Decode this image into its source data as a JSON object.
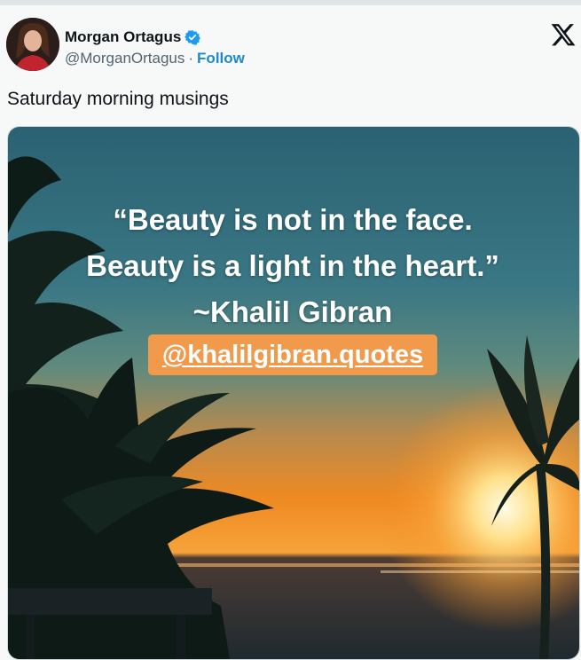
{
  "author": {
    "display_name": "Morgan Ortagus",
    "handle": "@MorganOrtagus",
    "separator": "·",
    "follow_label": "Follow",
    "verified": true,
    "verified_color": "#1d9bf0"
  },
  "icons": {
    "verified": "verified-badge-icon",
    "platform": "x-logo-icon"
  },
  "tweet": {
    "text": "Saturday morning musings"
  },
  "media": {
    "quote_line_1": "“Beauty is not in the face.",
    "quote_line_2": "Beauty is a light in the heart.”",
    "quote_author": "~Khalil Gibran",
    "tag": "@khalilgibran.quotes",
    "tag_color": "#f29a4c",
    "sky_color": "#2d6a7c",
    "sun_color": "#ffd27a"
  }
}
